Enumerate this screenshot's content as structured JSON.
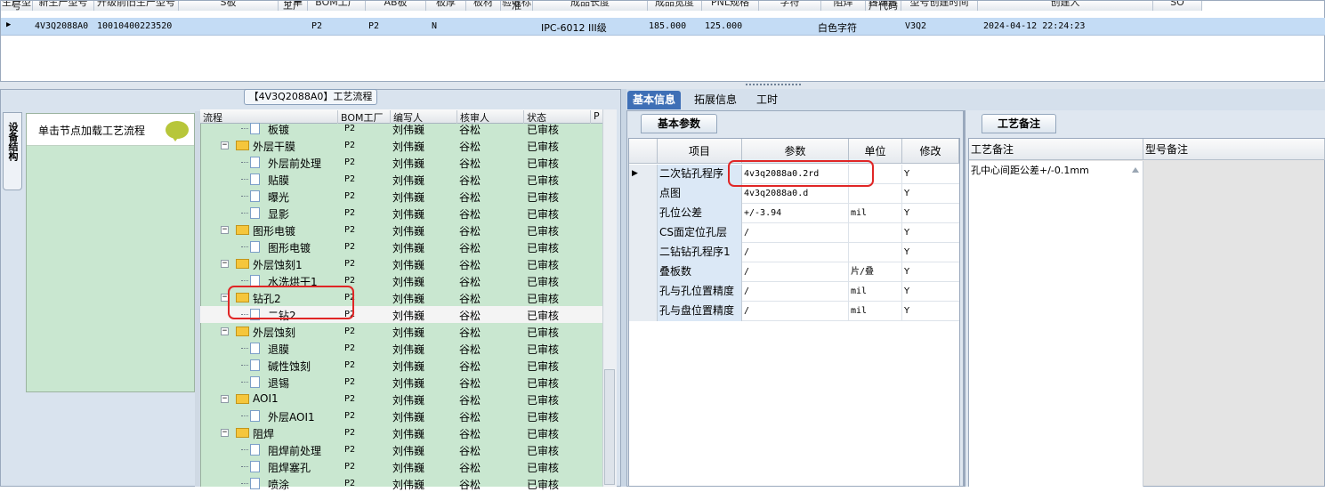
{
  "top_grid": {
    "columns": [
      "生产型号",
      "新生产型号",
      "升级前旧生产型号",
      "S板",
      "订单工厂",
      "BOM工厂",
      "AB板",
      "板厚",
      "板材",
      "验收标准",
      "成品长度",
      "成品宽度",
      "PNL规格",
      "字符",
      "阻焊",
      "终端客户代码",
      "型号创建时间",
      "创建人",
      "SO"
    ],
    "row": {
      "model": "4V3Q2088A0",
      "new_model": "10010400223520",
      "order_factory": "P2",
      "bom_factory": "P2",
      "ab_board": "N",
      "standard": "IPC-6012 III级",
      "length": "185.000",
      "width": "125.000",
      "char": "白色字符",
      "customer_code": "V3Q2",
      "created_time": "2024-04-12 22:24:23"
    }
  },
  "left_panel": {
    "flow_title": "【4V3Q2088A0】工艺流程",
    "side_tab": "设备结构",
    "hint": "单击节点加载工艺流程",
    "tree_headers": [
      "流程",
      "BOM工厂",
      "编写人",
      "核审人",
      "状态",
      "P"
    ],
    "rows": [
      {
        "name": "板镀",
        "type": "doc",
        "level": 2,
        "factory": "P2",
        "writer": "刘伟巍",
        "reviewer": "谷松",
        "status": "已审核"
      },
      {
        "name": "外层干膜",
        "type": "folder",
        "level": 1,
        "factory": "P2",
        "writer": "刘伟巍",
        "reviewer": "谷松",
        "status": "已审核"
      },
      {
        "name": "外层前处理",
        "type": "doc",
        "level": 2,
        "factory": "P2",
        "writer": "刘伟巍",
        "reviewer": "谷松",
        "status": "已审核"
      },
      {
        "name": "贴膜",
        "type": "doc",
        "level": 2,
        "factory": "P2",
        "writer": "刘伟巍",
        "reviewer": "谷松",
        "status": "已审核"
      },
      {
        "name": "曝光",
        "type": "doc",
        "level": 2,
        "factory": "P2",
        "writer": "刘伟巍",
        "reviewer": "谷松",
        "status": "已审核"
      },
      {
        "name": "显影",
        "type": "doc",
        "level": 2,
        "factory": "P2",
        "writer": "刘伟巍",
        "reviewer": "谷松",
        "status": "已审核"
      },
      {
        "name": "图形电镀",
        "type": "folder",
        "level": 1,
        "factory": "P2",
        "writer": "刘伟巍",
        "reviewer": "谷松",
        "status": "已审核"
      },
      {
        "name": "图形电镀",
        "type": "doc",
        "level": 2,
        "factory": "P2",
        "writer": "刘伟巍",
        "reviewer": "谷松",
        "status": "已审核"
      },
      {
        "name": "外层蚀刻1",
        "type": "folder",
        "level": 1,
        "factory": "P2",
        "writer": "刘伟巍",
        "reviewer": "谷松",
        "status": "已审核"
      },
      {
        "name": "水洗烘干1",
        "type": "doc",
        "level": 2,
        "factory": "P2",
        "writer": "刘伟巍",
        "reviewer": "谷松",
        "status": "已审核"
      },
      {
        "name": "钻孔2",
        "type": "folder",
        "level": 1,
        "factory": "P2",
        "writer": "刘伟巍",
        "reviewer": "谷松",
        "status": "已审核"
      },
      {
        "name": "二钻2",
        "type": "doc",
        "level": 2,
        "factory": "P2",
        "writer": "刘伟巍",
        "reviewer": "谷松",
        "status": "已审核",
        "selected": true
      },
      {
        "name": "外层蚀刻",
        "type": "folder",
        "level": 1,
        "factory": "P2",
        "writer": "刘伟巍",
        "reviewer": "谷松",
        "status": "已审核"
      },
      {
        "name": "退膜",
        "type": "doc",
        "level": 2,
        "factory": "P2",
        "writer": "刘伟巍",
        "reviewer": "谷松",
        "status": "已审核"
      },
      {
        "name": "碱性蚀刻",
        "type": "doc",
        "level": 2,
        "factory": "P2",
        "writer": "刘伟巍",
        "reviewer": "谷松",
        "status": "已审核"
      },
      {
        "name": "退锡",
        "type": "doc",
        "level": 2,
        "factory": "P2",
        "writer": "刘伟巍",
        "reviewer": "谷松",
        "status": "已审核"
      },
      {
        "name": "AOI1",
        "type": "folder",
        "level": 1,
        "factory": "P2",
        "writer": "刘伟巍",
        "reviewer": "谷松",
        "status": "已审核"
      },
      {
        "name": "外层AOI1",
        "type": "doc",
        "level": 2,
        "factory": "P2",
        "writer": "刘伟巍",
        "reviewer": "谷松",
        "status": "已审核"
      },
      {
        "name": "阻焊",
        "type": "folder",
        "level": 1,
        "factory": "P2",
        "writer": "刘伟巍",
        "reviewer": "谷松",
        "status": "已审核"
      },
      {
        "name": "阻焊前处理",
        "type": "doc",
        "level": 2,
        "factory": "P2",
        "writer": "刘伟巍",
        "reviewer": "谷松",
        "status": "已审核"
      },
      {
        "name": "阻焊塞孔",
        "type": "doc",
        "level": 2,
        "factory": "P2",
        "writer": "刘伟巍",
        "reviewer": "谷松",
        "status": "已审核"
      },
      {
        "name": "喷涂",
        "type": "doc",
        "level": 2,
        "factory": "P2",
        "writer": "刘伟巍",
        "reviewer": "谷松",
        "status": "已审核"
      }
    ]
  },
  "right_panel": {
    "tabs": [
      "基本信息",
      "拓展信息",
      "工时"
    ],
    "params_tab": "基本参数",
    "param_headers": [
      "项目",
      "参数",
      "单位",
      "修改"
    ],
    "params": [
      {
        "item": "二次钻孔程序",
        "value": "4v3q2088a0.2rd",
        "unit": "",
        "modify": "Y"
      },
      {
        "item": "点图",
        "value": "4v3q2088a0.d",
        "unit": "",
        "modify": "Y"
      },
      {
        "item": "孔位公差",
        "value": "+/-3.94",
        "unit": "mil",
        "modify": "Y"
      },
      {
        "item": "CS面定位孔层",
        "value": "/",
        "unit": "",
        "modify": "Y"
      },
      {
        "item": "二钻钻孔程序1",
        "value": "/",
        "unit": "",
        "modify": "Y"
      },
      {
        "item": "叠板数",
        "value": "/",
        "unit": "片/叠",
        "modify": "Y"
      },
      {
        "item": "孔与孔位置精度",
        "value": "/",
        "unit": "mil",
        "modify": "Y"
      },
      {
        "item": "孔与盘位置精度",
        "value": "/",
        "unit": "mil",
        "modify": "Y"
      }
    ],
    "notes_tab": "工艺备注",
    "notes_headers": [
      "工艺备注",
      "型号备注"
    ],
    "note_text": "孔中心间距公差+/-0.1mm"
  },
  "colors": {
    "tree_bg": "#c9e7d0",
    "selection_row": "#c4dcf5",
    "active_tab": "#3e6fb6",
    "highlight_box": "#e02626"
  }
}
